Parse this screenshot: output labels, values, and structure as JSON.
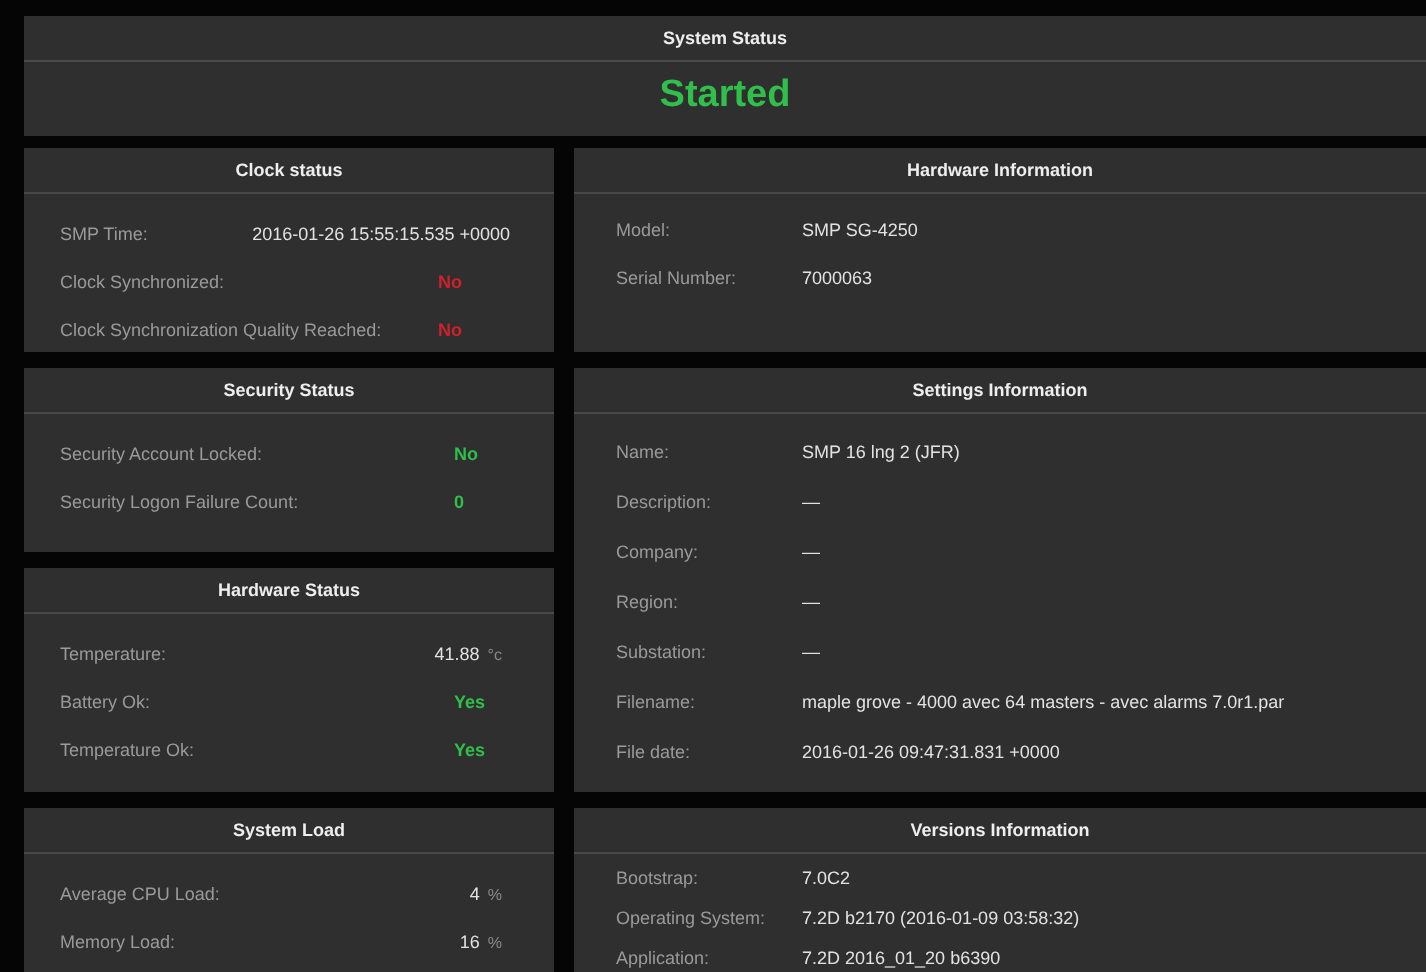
{
  "system_status": {
    "title": "System Status",
    "state": "Started",
    "color": "#2fbf4a"
  },
  "left_panels": [
    {
      "title": "Clock status",
      "rows": [
        {
          "label": "SMP Time:",
          "value": "2016-01-26 15:55:15.535 +0000",
          "color": "#e2e2e2"
        },
        {
          "label": "Clock Synchronized:",
          "value": "No",
          "color": "#d0202a"
        },
        {
          "label": "Clock Synchronization Quality Reached:",
          "value": "No",
          "color": "#d0202a"
        }
      ]
    },
    {
      "title": "Security Status",
      "rows": [
        {
          "label": "Security Account Locked:",
          "value": "No",
          "color": "#2fbf4a"
        },
        {
          "label": "Security Logon Failure Count:",
          "value": "0",
          "color": "#2fbf4a"
        }
      ]
    },
    {
      "title": "Hardware Status",
      "rows": [
        {
          "label": "Temperature:",
          "value": "41.88",
          "unit": "°c",
          "color": "#e2e2e2"
        },
        {
          "label": "Battery Ok:",
          "value": "Yes",
          "color": "#2fbf4a"
        },
        {
          "label": "Temperature Ok:",
          "value": "Yes",
          "color": "#2fbf4a"
        }
      ]
    },
    {
      "title": "System Load",
      "rows": [
        {
          "label": "Average CPU Load:",
          "value": "4",
          "unit": "%",
          "color": "#e2e2e2"
        },
        {
          "label": "Memory Load:",
          "value": "16",
          "unit": "%",
          "color": "#e2e2e2"
        }
      ]
    }
  ],
  "right_panels": [
    {
      "title": "Hardware Information",
      "rows": [
        {
          "label": "Model:",
          "value": "SMP SG-4250"
        },
        {
          "label": "Serial Number:",
          "value": "7000063"
        }
      ]
    },
    {
      "title": "Settings Information",
      "rows": [
        {
          "label": "Name:",
          "value": "SMP 16 lng 2 (JFR)"
        },
        {
          "label": "Description:",
          "value": "—"
        },
        {
          "label": "Company:",
          "value": "—"
        },
        {
          "label": "Region:",
          "value": "—"
        },
        {
          "label": "Substation:",
          "value": "—"
        },
        {
          "label": "Filename:",
          "value": "maple grove - 4000 avec 64 masters - avec alarms 7.0r1.par"
        },
        {
          "label": "File date:",
          "value": "2016-01-26 09:47:31.831 +0000"
        }
      ]
    },
    {
      "title": "Versions Information",
      "rows": [
        {
          "label": "Bootstrap:",
          "value": "7.0C2"
        },
        {
          "label": "Operating System:",
          "value": "7.2D b2170 (2016-01-09 03:58:32)"
        },
        {
          "label": "Application:",
          "value": "7.2D 2016_01_20 b6390"
        }
      ]
    }
  ]
}
